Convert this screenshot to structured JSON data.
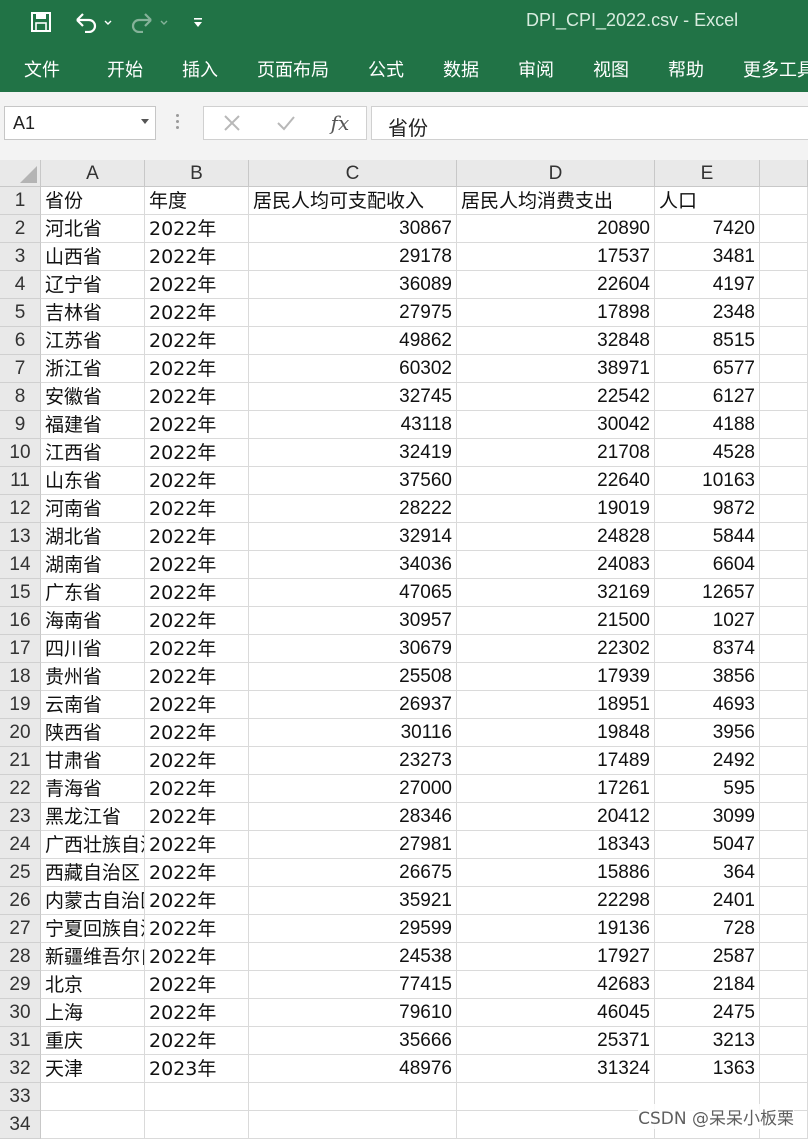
{
  "window": {
    "title": "DPI_CPI_2022.csv  -  Excel"
  },
  "quick_access": {
    "save_icon": "save-icon",
    "undo_icon": "undo-icon",
    "redo_icon": "redo-icon",
    "customize_icon": "customize-qat-icon"
  },
  "ribbon": {
    "tabs": [
      "文件",
      "开始",
      "插入",
      "页面布局",
      "公式",
      "数据",
      "审阅",
      "视图",
      "帮助",
      "更多工具"
    ]
  },
  "formula_bar": {
    "name_box": "A1",
    "cancel_icon": "cancel-icon",
    "enter_icon": "enter-icon",
    "fx_label": "fx",
    "content": "省份"
  },
  "sheet": {
    "columns": [
      "A",
      "B",
      "C",
      "D",
      "E"
    ],
    "row_numbers": [
      "1",
      "2",
      "3",
      "4",
      "5",
      "6",
      "7",
      "8",
      "9",
      "10",
      "11",
      "12",
      "13",
      "14",
      "15",
      "16",
      "17",
      "18",
      "19",
      "20",
      "21",
      "22",
      "23",
      "24",
      "25",
      "26",
      "27",
      "28",
      "29",
      "30",
      "31",
      "32",
      "33",
      "34"
    ],
    "header": [
      "省份",
      "年度",
      "居民人均可支配收入",
      "居民人均消费支出",
      "人口"
    ],
    "rows": [
      [
        "河北省",
        "2022年",
        "30867",
        "20890",
        "7420"
      ],
      [
        "山西省",
        "2022年",
        "29178",
        "17537",
        "3481"
      ],
      [
        "辽宁省",
        "2022年",
        "36089",
        "22604",
        "4197"
      ],
      [
        "吉林省",
        "2022年",
        "27975",
        "17898",
        "2348"
      ],
      [
        "江苏省",
        "2022年",
        "49862",
        "32848",
        "8515"
      ],
      [
        "浙江省",
        "2022年",
        "60302",
        "38971",
        "6577"
      ],
      [
        "安徽省",
        "2022年",
        "32745",
        "22542",
        "6127"
      ],
      [
        "福建省",
        "2022年",
        "43118",
        "30042",
        "4188"
      ],
      [
        "江西省",
        "2022年",
        "32419",
        "21708",
        "4528"
      ],
      [
        "山东省",
        "2022年",
        "37560",
        "22640",
        "10163"
      ],
      [
        "河南省",
        "2022年",
        "28222",
        "19019",
        "9872"
      ],
      [
        "湖北省",
        "2022年",
        "32914",
        "24828",
        "5844"
      ],
      [
        "湖南省",
        "2022年",
        "34036",
        "24083",
        "6604"
      ],
      [
        "广东省",
        "2022年",
        "47065",
        "32169",
        "12657"
      ],
      [
        "海南省",
        "2022年",
        "30957",
        "21500",
        "1027"
      ],
      [
        "四川省",
        "2022年",
        "30679",
        "22302",
        "8374"
      ],
      [
        "贵州省",
        "2022年",
        "25508",
        "17939",
        "3856"
      ],
      [
        "云南省",
        "2022年",
        "26937",
        "18951",
        "4693"
      ],
      [
        "陕西省",
        "2022年",
        "30116",
        "19848",
        "3956"
      ],
      [
        "甘肃省",
        "2022年",
        "23273",
        "17489",
        "2492"
      ],
      [
        "青海省",
        "2022年",
        "27000",
        "17261",
        "595"
      ],
      [
        "黑龙江省",
        "2022年",
        "28346",
        "20412",
        "3099"
      ],
      [
        "广西壮族自治区",
        "2022年",
        "27981",
        "18343",
        "5047"
      ],
      [
        "西藏自治区",
        "2022年",
        "26675",
        "15886",
        "364"
      ],
      [
        "内蒙古自治区",
        "2022年",
        "35921",
        "22298",
        "2401"
      ],
      [
        "宁夏回族自治区",
        "2022年",
        "29599",
        "19136",
        "728"
      ],
      [
        "新疆维吾尔自治区",
        "2022年",
        "24538",
        "17927",
        "2587"
      ],
      [
        "北京",
        "2022年",
        "77415",
        "42683",
        "2184"
      ],
      [
        "上海",
        "2022年",
        "79610",
        "46045",
        "2475"
      ],
      [
        "重庆",
        "2022年",
        "35666",
        "25371",
        "3213"
      ],
      [
        "天津",
        "2023年",
        "48976",
        "31324",
        "1363"
      ]
    ]
  },
  "watermark": "CSDN @呆呆小板栗",
  "colors": {
    "excel_green": "#217346",
    "grid_line": "#dadada",
    "header_bg": "#e9e9e9"
  }
}
